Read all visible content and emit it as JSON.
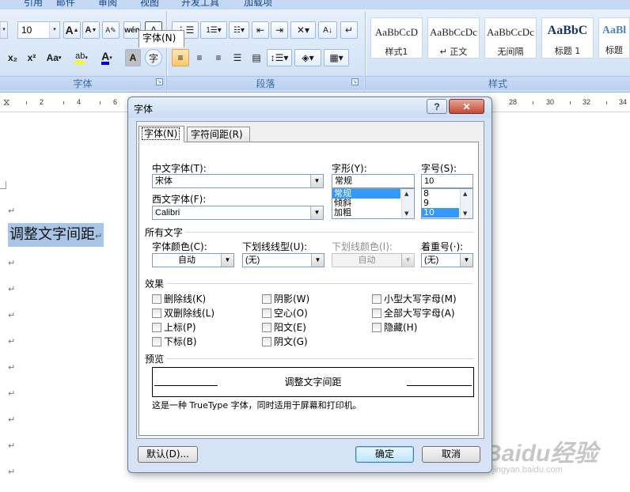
{
  "ribbon": {
    "tabs": [
      "引用",
      "邮件",
      "审阅",
      "视图",
      "开发工具",
      "加载项"
    ],
    "font_group": {
      "label": "字体",
      "font_size": "10",
      "buttons": [
        "A",
        "A",
        "Aa",
        "wén",
        "A",
        "x₂",
        "x²",
        "Aa",
        "ab",
        "A",
        "A",
        "字"
      ]
    },
    "paragraph_group": {
      "label": "段落"
    },
    "styles_group": {
      "label": "样式",
      "styles": [
        {
          "sample": "AaBbCcD",
          "name": "样式1"
        },
        {
          "sample": "AaBbCcDc",
          "name": "↵ 正文"
        },
        {
          "sample": "AaBbCcDc",
          "name": "无间隔"
        },
        {
          "sample": "AaBbC",
          "name": "标题 1"
        },
        {
          "sample": "AaBl",
          "name": "标题"
        }
      ]
    },
    "accent_color": "#e7a54a"
  },
  "ruler": {
    "left_numbers": [
      "2",
      "4",
      "6"
    ],
    "right_numbers": [
      "28",
      "30",
      "32",
      "34"
    ]
  },
  "document": {
    "text": "调整文字间距",
    "paragraph_mark": "↵"
  },
  "dialog": {
    "title": "字体",
    "help": "?",
    "close": "✕",
    "tabs": [
      "字体(N)",
      "字符间距(R)"
    ],
    "chinese_font": {
      "label": "中文字体(T):",
      "value": "宋体"
    },
    "western_font": {
      "label": "西文字体(F):",
      "value": "Calibri"
    },
    "style": {
      "label": "字形(Y):",
      "value": "常规",
      "options": [
        "常规",
        "倾斜",
        "加粗"
      ],
      "selected": "常规"
    },
    "size": {
      "label": "字号(S):",
      "value": "10",
      "options": [
        "8",
        "9",
        "10"
      ],
      "selected": "10"
    },
    "all_text_section": "所有文字",
    "font_color": {
      "label": "字体颜色(C):",
      "value": "自动"
    },
    "underline_style": {
      "label": "下划线线型(U):",
      "value": "(无)"
    },
    "underline_color": {
      "label": "下划线颜色(I):",
      "value": "自动"
    },
    "emphasis": {
      "label": "着重号(·):",
      "value": "(无)"
    },
    "effects_section": "效果",
    "effects": {
      "col1": [
        "删除线(K)",
        "双删除线(L)",
        "上标(P)",
        "下标(B)"
      ],
      "col2": [
        "阴影(W)",
        "空心(O)",
        "阳文(E)",
        "阴文(G)"
      ],
      "col3": [
        "小型大写字母(M)",
        "全部大写字母(A)",
        "隐藏(H)"
      ]
    },
    "preview_section": "预览",
    "preview_text": "调整文字间距",
    "note": "这是一种 TrueType 字体，同时适用于屏幕和打印机。",
    "buttons": {
      "default": "默认(D)...",
      "ok": "确定",
      "cancel": "取消"
    }
  },
  "watermark": {
    "main": "Baidu经验",
    "url": "jingyan.baidu.com"
  }
}
